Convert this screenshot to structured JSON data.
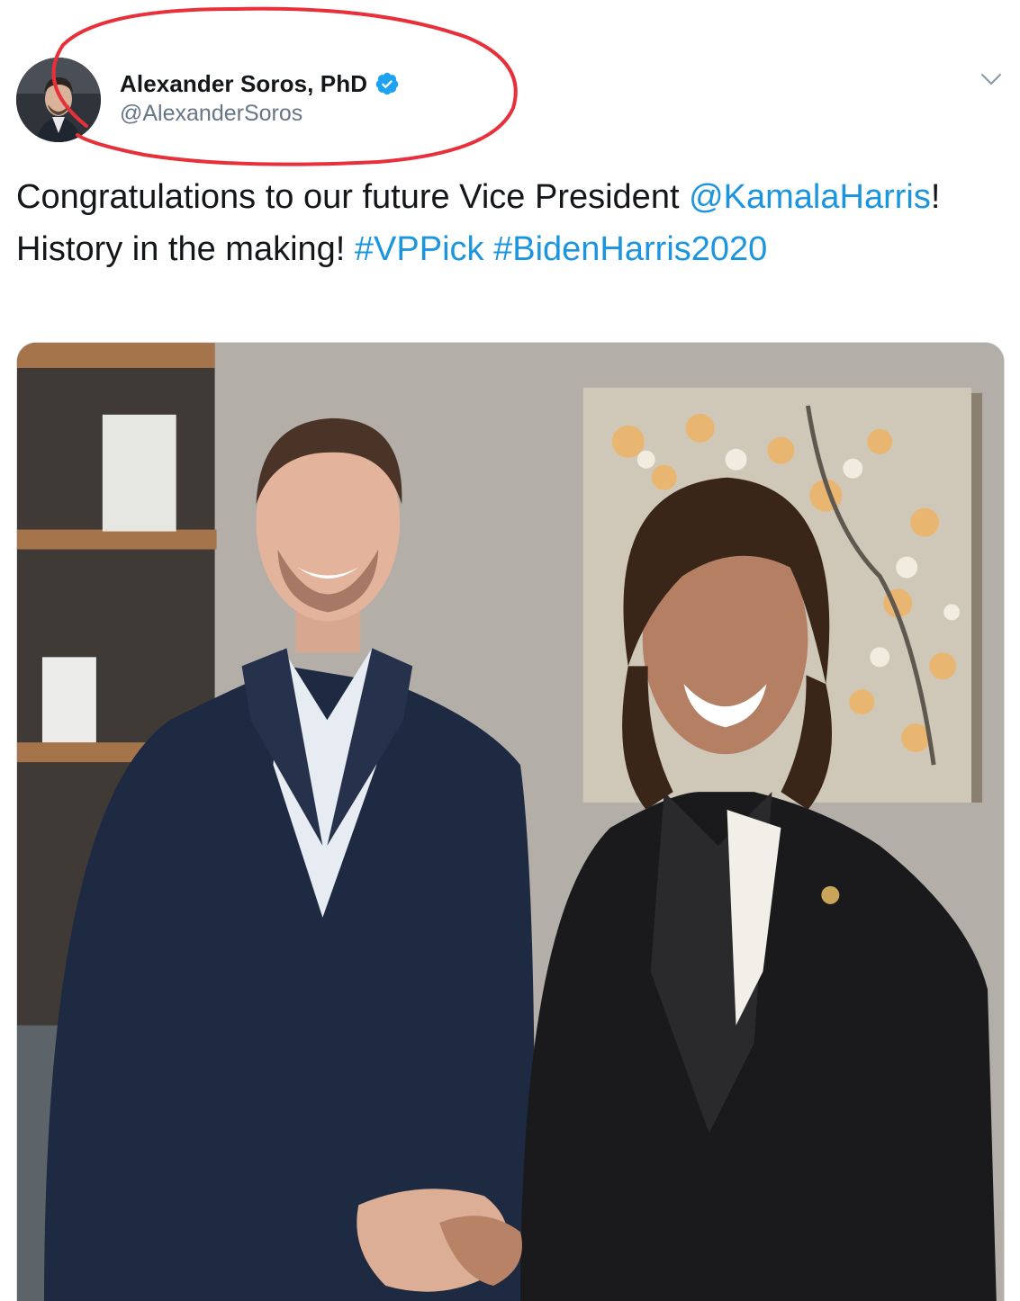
{
  "tweet": {
    "author": {
      "display_name": "Alexander Soros, PhD",
      "handle": "@AlexanderSoros",
      "verified": true
    },
    "text_segments": [
      {
        "text": "Congratulations to our future Vice President ",
        "type": "text"
      },
      {
        "text": "@KamalaHarris",
        "type": "mention"
      },
      {
        "text": "! History in the making! ",
        "type": "text"
      },
      {
        "text": "#VPPick",
        "type": "hashtag"
      },
      {
        "text": " ",
        "type": "text"
      },
      {
        "text": "#BidenHarris2020",
        "type": "hashtag"
      }
    ],
    "menu_icon": "chevron-down-icon",
    "media": {
      "kind": "photo",
      "description_icon": "photo"
    }
  },
  "annotation": {
    "kind": "hand-drawn oval",
    "color": "#e8303a"
  },
  "colors": {
    "link": "#1b95e0",
    "verified": "#1da1f2",
    "secondary_text": "#657786",
    "primary_text": "#14171a"
  }
}
